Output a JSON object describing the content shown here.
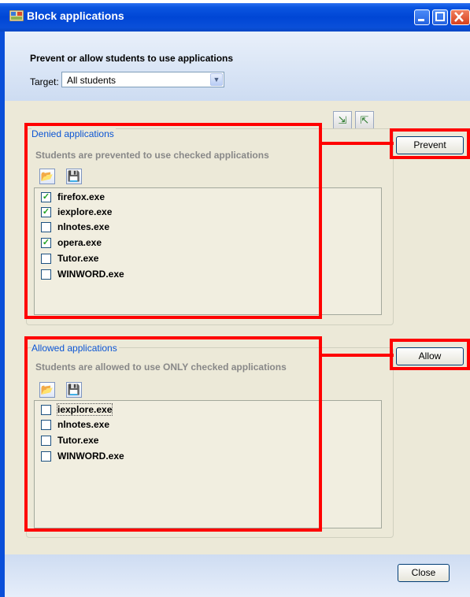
{
  "window": {
    "title": "Block applications"
  },
  "heading": "Prevent or allow students to use applications",
  "target": {
    "label": "Target:",
    "value": "All students"
  },
  "denied": {
    "legend": "Denied applications",
    "description": "Students are prevented to use checked applications",
    "items": [
      {
        "label": "firefox.exe",
        "checked": true
      },
      {
        "label": "iexplore.exe",
        "checked": true
      },
      {
        "label": "nlnotes.exe",
        "checked": false
      },
      {
        "label": "opera.exe",
        "checked": true
      },
      {
        "label": "Tutor.exe",
        "checked": false
      },
      {
        "label": "WINWORD.exe",
        "checked": false
      }
    ],
    "button": "Prevent"
  },
  "allowed": {
    "legend": "Allowed applications",
    "description": "Students are allowed to use ONLY checked applications",
    "items": [
      {
        "label": "iexplore.exe",
        "checked": false
      },
      {
        "label": "nlnotes.exe",
        "checked": false
      },
      {
        "label": "Tutor.exe",
        "checked": false
      },
      {
        "label": "WINWORD.exe",
        "checked": false
      }
    ],
    "button": "Allow"
  },
  "footer": {
    "close_label": "Close"
  },
  "colors": {
    "highlight": "#ff0000",
    "titlebar": "#0046d5",
    "legend": "#0b55d4"
  }
}
